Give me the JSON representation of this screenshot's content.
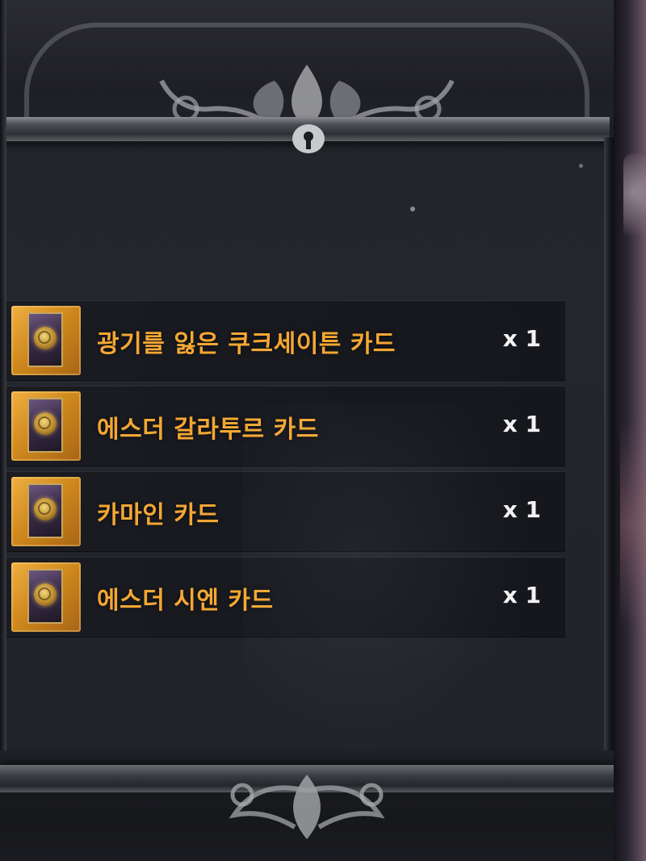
{
  "rewards": {
    "items": [
      {
        "name": "광기를 잃은 쿠크세이튼 카드",
        "quantity": "x 1",
        "icon": "card-icon"
      },
      {
        "name": "에스더 갈라투르 카드",
        "quantity": "x 1",
        "icon": "card-icon"
      },
      {
        "name": "카마인 카드",
        "quantity": "x 1",
        "icon": "card-icon"
      },
      {
        "name": "에스더 시엔 카드",
        "quantity": "x 1",
        "icon": "card-icon"
      }
    ]
  },
  "colors": {
    "item_name": "#f4a733",
    "quantity": "#f2f2f2",
    "icon_frame": "#d08a1e",
    "background": "#22252c"
  }
}
